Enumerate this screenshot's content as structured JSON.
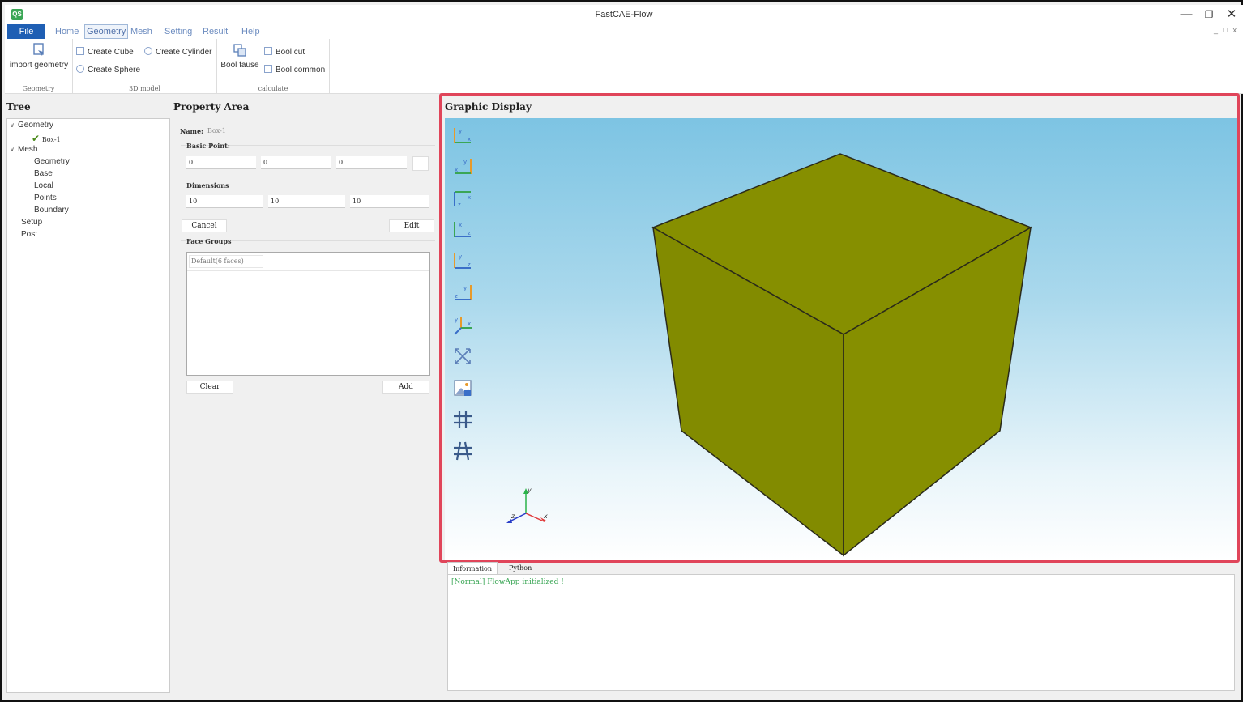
{
  "window": {
    "title": "FastCAE-Flow",
    "app_icon": "QS"
  },
  "menu": {
    "file": "File",
    "tabs": [
      "Home",
      "Geometry",
      "Mesh",
      "Setting",
      "Result",
      "Help"
    ],
    "active_tab": "Geometry"
  },
  "ribbon": {
    "geometry_group": {
      "label": "Geometry",
      "import": "import geometry"
    },
    "model_group": {
      "label": "3D model",
      "cube": "Create Cube",
      "cylinder": "Create Cylinder",
      "sphere": "Create Sphere"
    },
    "calc_group": {
      "label": "calculate",
      "bool_fause": "Bool fause",
      "bool_cut": "Bool cut",
      "bool_common": "Bool common"
    }
  },
  "tree": {
    "header": "Tree",
    "items": [
      {
        "label": "Geometry"
      },
      {
        "label": "Box-1"
      },
      {
        "label": "Mesh"
      },
      {
        "label": "Geometry"
      },
      {
        "label": "Base"
      },
      {
        "label": "Local"
      },
      {
        "label": "Points"
      },
      {
        "label": "Boundary"
      },
      {
        "label": "Setup"
      },
      {
        "label": "Post"
      }
    ]
  },
  "property": {
    "header": "Property Area",
    "name_label": "Name:",
    "name_value": "Box-1",
    "basic_point_label": "Basic Point:",
    "basic_point": [
      "0",
      "0",
      "0"
    ],
    "dimensions_label": "Dimensions",
    "dimensions": [
      "10",
      "10",
      "10"
    ],
    "cancel": "Cancel",
    "edit": "Edit",
    "face_groups_label": "Face Groups",
    "face_group_item": "Default(6 faces)",
    "clear": "Clear",
    "add": "Add"
  },
  "graphic": {
    "header": "Graphic Display",
    "cube_color": "#858e00",
    "highlight_color": "#e0455a"
  },
  "toolbar_icons": [
    "view-xy-icon",
    "view-yx-icon",
    "view-zx-icon",
    "view-xz-icon",
    "view-yz-icon",
    "view-zy-icon",
    "view-iso-icon",
    "fit-view-icon",
    "screenshot-icon",
    "grid-icon",
    "mesh-grid-icon"
  ],
  "info": {
    "tabs": [
      "Information",
      "Python"
    ],
    "log": "[Normal] FlowApp initialized !"
  }
}
